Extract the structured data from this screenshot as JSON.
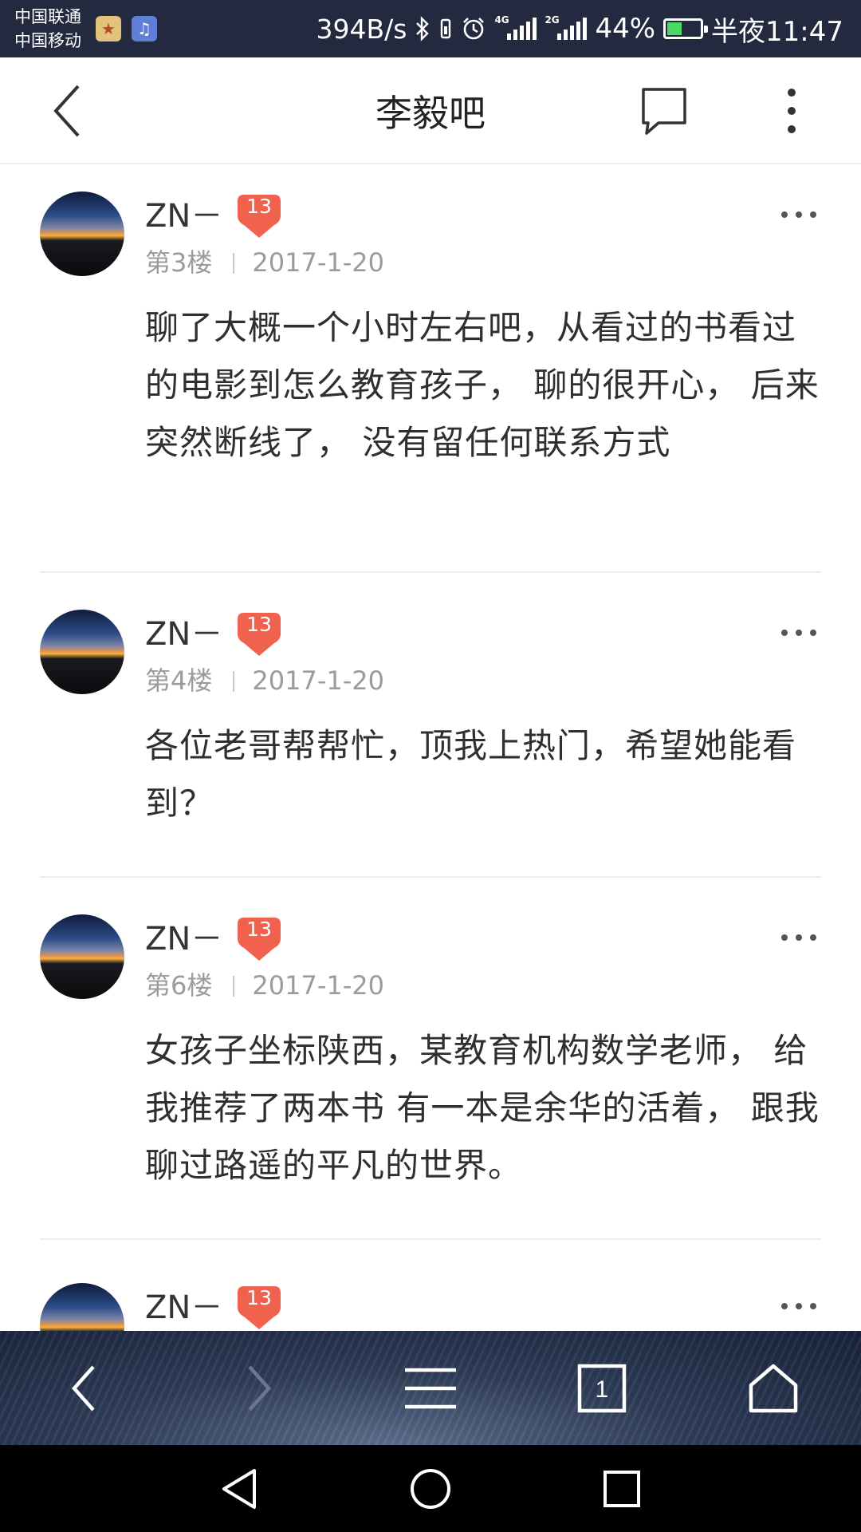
{
  "status_bar": {
    "carrier_1": "中国联通",
    "carrier_2": "中国移动",
    "net_speed": "394B/s",
    "signal_1_tag": "4G",
    "signal_2_tag": "2G",
    "battery_percent": "44%",
    "battery_level": 0.44,
    "time": "半夜11:47"
  },
  "header": {
    "title": "李毅吧"
  },
  "posts": [
    {
      "username": "ZN－",
      "level": "13",
      "floor": "第3楼",
      "date": "2017-1-20",
      "content": "聊了大概一个小时左右吧，从看过的书看过的电影到怎么教育孩子， 聊的很开心， 后来突然断线了， 没有留任何联系方式"
    },
    {
      "username": "ZN－",
      "level": "13",
      "floor": "第4楼",
      "date": "2017-1-20",
      "content": "各位老哥帮帮忙，顶我上热门，希望她能看到？"
    },
    {
      "username": "ZN－",
      "level": "13",
      "floor": "第6楼",
      "date": "2017-1-20",
      "content": "女孩子坐标陕西，某教育机构数学老师， 给我推荐了两本书 有一本是余华的活着， 跟我聊过路遥的平凡的世界。"
    },
    {
      "username": "ZN－",
      "level": "13",
      "floor": "",
      "date": "",
      "content": ""
    }
  ],
  "toolbar": {
    "tabs_count": "1"
  },
  "colors": {
    "status_bar_bg": "#232a3f",
    "level_badge": "#f0624d",
    "meta_text": "#9b9b9b",
    "battery_fill": "#4cd964"
  },
  "icons": {
    "header": [
      "back-icon",
      "reply-icon",
      "more-vertical-icon"
    ],
    "toolbar": [
      "back-icon",
      "forward-icon",
      "menu-icon",
      "tabs-icon",
      "home-icon"
    ],
    "navbar": [
      "nav-back-icon",
      "nav-home-icon",
      "nav-recents-icon"
    ]
  }
}
